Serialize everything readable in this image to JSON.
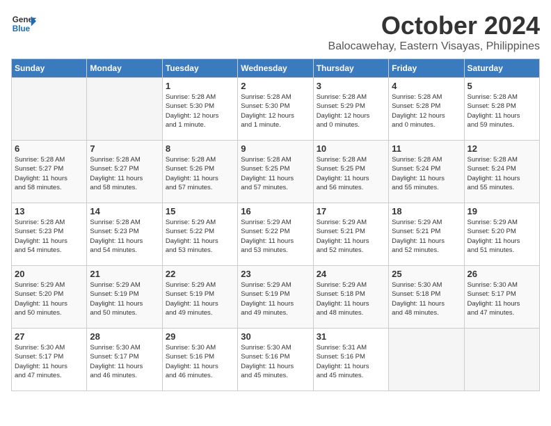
{
  "logo": {
    "line1": "General",
    "line2": "Blue"
  },
  "title": "October 2024",
  "subtitle": "Balocawehay, Eastern Visayas, Philippines",
  "headers": [
    "Sunday",
    "Monday",
    "Tuesday",
    "Wednesday",
    "Thursday",
    "Friday",
    "Saturday"
  ],
  "weeks": [
    [
      {
        "day": "",
        "info": ""
      },
      {
        "day": "",
        "info": ""
      },
      {
        "day": "1",
        "info": "Sunrise: 5:28 AM\nSunset: 5:30 PM\nDaylight: 12 hours\nand 1 minute."
      },
      {
        "day": "2",
        "info": "Sunrise: 5:28 AM\nSunset: 5:30 PM\nDaylight: 12 hours\nand 1 minute."
      },
      {
        "day": "3",
        "info": "Sunrise: 5:28 AM\nSunset: 5:29 PM\nDaylight: 12 hours\nand 0 minutes."
      },
      {
        "day": "4",
        "info": "Sunrise: 5:28 AM\nSunset: 5:28 PM\nDaylight: 12 hours\nand 0 minutes."
      },
      {
        "day": "5",
        "info": "Sunrise: 5:28 AM\nSunset: 5:28 PM\nDaylight: 11 hours\nand 59 minutes."
      }
    ],
    [
      {
        "day": "6",
        "info": "Sunrise: 5:28 AM\nSunset: 5:27 PM\nDaylight: 11 hours\nand 58 minutes."
      },
      {
        "day": "7",
        "info": "Sunrise: 5:28 AM\nSunset: 5:27 PM\nDaylight: 11 hours\nand 58 minutes."
      },
      {
        "day": "8",
        "info": "Sunrise: 5:28 AM\nSunset: 5:26 PM\nDaylight: 11 hours\nand 57 minutes."
      },
      {
        "day": "9",
        "info": "Sunrise: 5:28 AM\nSunset: 5:25 PM\nDaylight: 11 hours\nand 57 minutes."
      },
      {
        "day": "10",
        "info": "Sunrise: 5:28 AM\nSunset: 5:25 PM\nDaylight: 11 hours\nand 56 minutes."
      },
      {
        "day": "11",
        "info": "Sunrise: 5:28 AM\nSunset: 5:24 PM\nDaylight: 11 hours\nand 55 minutes."
      },
      {
        "day": "12",
        "info": "Sunrise: 5:28 AM\nSunset: 5:24 PM\nDaylight: 11 hours\nand 55 minutes."
      }
    ],
    [
      {
        "day": "13",
        "info": "Sunrise: 5:28 AM\nSunset: 5:23 PM\nDaylight: 11 hours\nand 54 minutes."
      },
      {
        "day": "14",
        "info": "Sunrise: 5:28 AM\nSunset: 5:23 PM\nDaylight: 11 hours\nand 54 minutes."
      },
      {
        "day": "15",
        "info": "Sunrise: 5:29 AM\nSunset: 5:22 PM\nDaylight: 11 hours\nand 53 minutes."
      },
      {
        "day": "16",
        "info": "Sunrise: 5:29 AM\nSunset: 5:22 PM\nDaylight: 11 hours\nand 53 minutes."
      },
      {
        "day": "17",
        "info": "Sunrise: 5:29 AM\nSunset: 5:21 PM\nDaylight: 11 hours\nand 52 minutes."
      },
      {
        "day": "18",
        "info": "Sunrise: 5:29 AM\nSunset: 5:21 PM\nDaylight: 11 hours\nand 52 minutes."
      },
      {
        "day": "19",
        "info": "Sunrise: 5:29 AM\nSunset: 5:20 PM\nDaylight: 11 hours\nand 51 minutes."
      }
    ],
    [
      {
        "day": "20",
        "info": "Sunrise: 5:29 AM\nSunset: 5:20 PM\nDaylight: 11 hours\nand 50 minutes."
      },
      {
        "day": "21",
        "info": "Sunrise: 5:29 AM\nSunset: 5:19 PM\nDaylight: 11 hours\nand 50 minutes."
      },
      {
        "day": "22",
        "info": "Sunrise: 5:29 AM\nSunset: 5:19 PM\nDaylight: 11 hours\nand 49 minutes."
      },
      {
        "day": "23",
        "info": "Sunrise: 5:29 AM\nSunset: 5:19 PM\nDaylight: 11 hours\nand 49 minutes."
      },
      {
        "day": "24",
        "info": "Sunrise: 5:29 AM\nSunset: 5:18 PM\nDaylight: 11 hours\nand 48 minutes."
      },
      {
        "day": "25",
        "info": "Sunrise: 5:30 AM\nSunset: 5:18 PM\nDaylight: 11 hours\nand 48 minutes."
      },
      {
        "day": "26",
        "info": "Sunrise: 5:30 AM\nSunset: 5:17 PM\nDaylight: 11 hours\nand 47 minutes."
      }
    ],
    [
      {
        "day": "27",
        "info": "Sunrise: 5:30 AM\nSunset: 5:17 PM\nDaylight: 11 hours\nand 47 minutes."
      },
      {
        "day": "28",
        "info": "Sunrise: 5:30 AM\nSunset: 5:17 PM\nDaylight: 11 hours\nand 46 minutes."
      },
      {
        "day": "29",
        "info": "Sunrise: 5:30 AM\nSunset: 5:16 PM\nDaylight: 11 hours\nand 46 minutes."
      },
      {
        "day": "30",
        "info": "Sunrise: 5:30 AM\nSunset: 5:16 PM\nDaylight: 11 hours\nand 45 minutes."
      },
      {
        "day": "31",
        "info": "Sunrise: 5:31 AM\nSunset: 5:16 PM\nDaylight: 11 hours\nand 45 minutes."
      },
      {
        "day": "",
        "info": ""
      },
      {
        "day": "",
        "info": ""
      }
    ]
  ]
}
